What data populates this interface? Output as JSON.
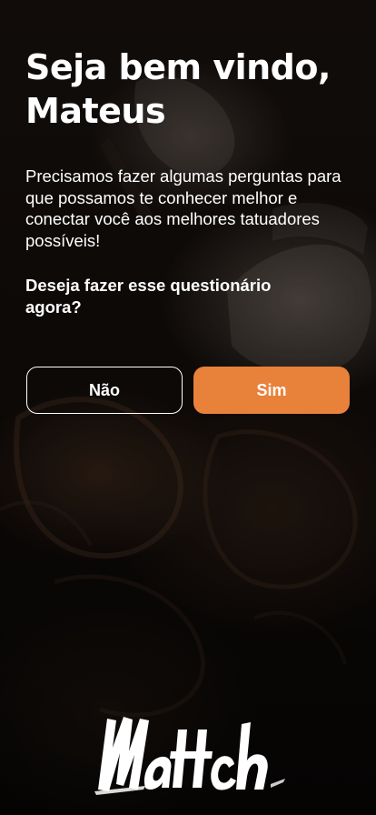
{
  "welcome": {
    "title": "Seja bem vindo, Mateus",
    "intro": "Precisamos fazer algumas perguntas para que possamos te conhecer melhor e conectar você aos melhores tatuadores possíveis!",
    "question": "Deseja fazer esse questionário agora?"
  },
  "buttons": {
    "no_label": "Não",
    "yes_label": "Sim"
  },
  "brand": {
    "logo_text": "Mattch",
    "accent_color": "#e8813a",
    "text_color": "#ffffff",
    "background_color": "#0f0b09"
  },
  "background": {
    "icon": "tattoo-artist-photo"
  }
}
